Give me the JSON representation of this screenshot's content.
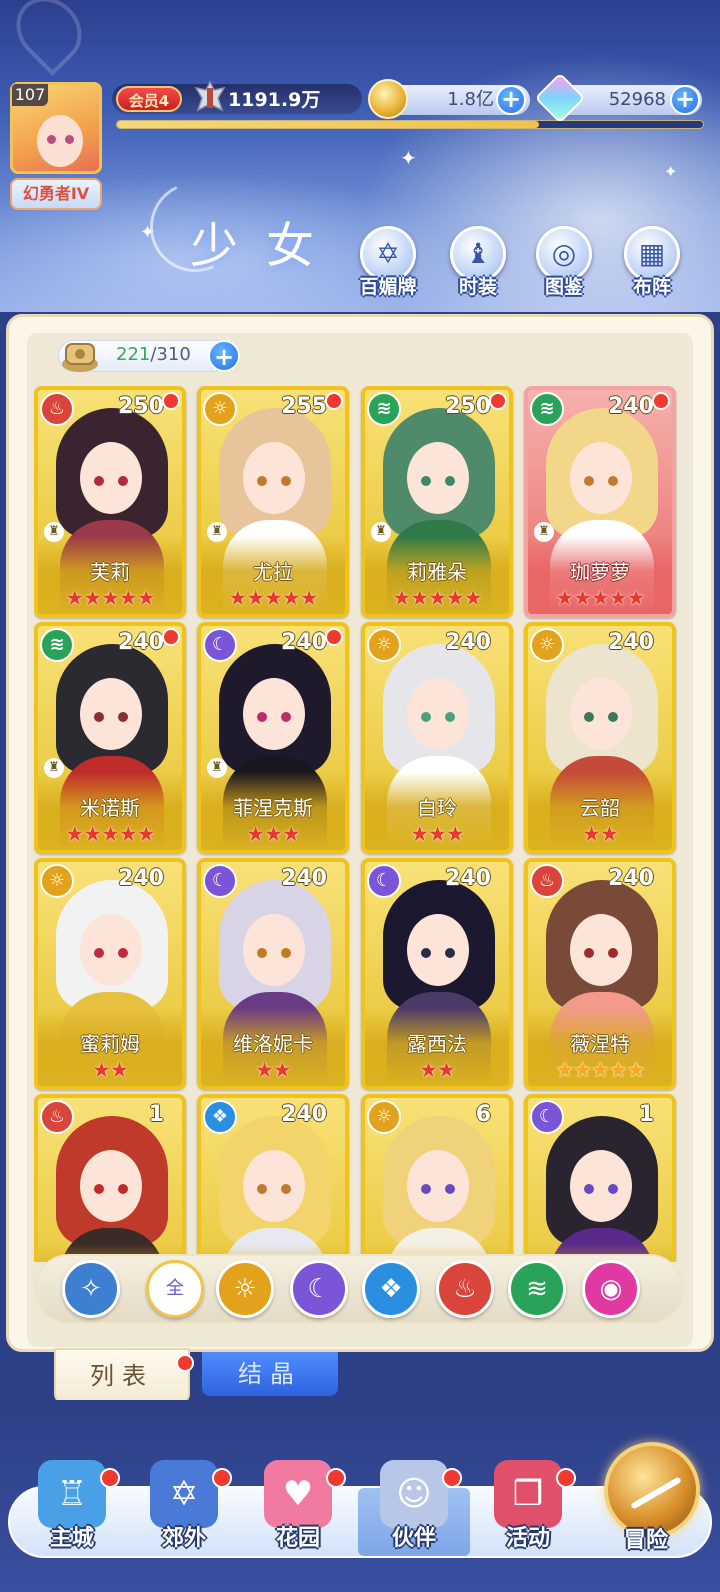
{
  "player": {
    "level": "107",
    "title": "幻勇者IV",
    "vip": "会员4",
    "power": "1191.9万",
    "exp_fraction": 0.72
  },
  "currency": {
    "gold": "1.8亿",
    "gems": "52968"
  },
  "page": {
    "title": "少女"
  },
  "top_buttons": [
    {
      "label": "百媚牌",
      "icon": "card-icon"
    },
    {
      "label": "时装",
      "icon": "costume-icon"
    },
    {
      "label": "图鉴",
      "icon": "book-icon"
    },
    {
      "label": "布阵",
      "icon": "formation-grid-icon"
    }
  ],
  "capacity": {
    "current": "221",
    "max": "/310"
  },
  "characters": [
    {
      "name": "芙莉",
      "level": "250",
      "element": "fire",
      "stars": 5,
      "star_color": "red",
      "frame": "gold",
      "has_rook": true,
      "dot": true
    },
    {
      "name": "尤拉",
      "level": "255",
      "element": "light",
      "stars": 5,
      "star_color": "red",
      "frame": "gold",
      "has_rook": true,
      "dot": true
    },
    {
      "name": "莉雅朵",
      "level": "250",
      "element": "wind",
      "stars": 5,
      "star_color": "red",
      "frame": "gold",
      "has_rook": true,
      "dot": true
    },
    {
      "name": "珈萝萝",
      "level": "240",
      "element": "wind",
      "stars": 5,
      "star_color": "red",
      "frame": "red",
      "has_rook": true,
      "dot": true
    },
    {
      "name": "米诺斯",
      "level": "240",
      "element": "wind",
      "stars": 5,
      "star_color": "red",
      "frame": "gold",
      "has_rook": true,
      "dot": true
    },
    {
      "name": "菲涅克斯",
      "level": "240",
      "element": "dark",
      "stars": 3,
      "star_color": "red",
      "frame": "gold",
      "has_rook": true,
      "dot": true
    },
    {
      "name": "白玲",
      "level": "240",
      "element": "light",
      "stars": 3,
      "star_color": "red",
      "frame": "gold",
      "has_rook": false,
      "dot": false
    },
    {
      "name": "云韶",
      "level": "240",
      "element": "light",
      "stars": 2,
      "star_color": "red",
      "frame": "gold",
      "has_rook": false,
      "dot": false
    },
    {
      "name": "蜜莉姆",
      "level": "240",
      "element": "light",
      "stars": 2,
      "star_color": "red",
      "frame": "gold",
      "has_rook": false,
      "dot": false
    },
    {
      "name": "维洛妮卡",
      "level": "240",
      "element": "dark",
      "stars": 2,
      "star_color": "red",
      "frame": "gold",
      "has_rook": false,
      "dot": false
    },
    {
      "name": "露西法",
      "level": "240",
      "element": "dark",
      "stars": 2,
      "star_color": "red",
      "frame": "gold",
      "has_rook": false,
      "dot": false
    },
    {
      "name": "薇涅特",
      "level": "240",
      "element": "fire",
      "stars": 5,
      "star_color": "gold",
      "frame": "gold",
      "has_rook": false,
      "dot": false
    },
    {
      "name": "",
      "level": "1",
      "element": "fire",
      "stars": 0,
      "star_color": "red",
      "frame": "gold",
      "has_rook": false,
      "dot": false
    },
    {
      "name": "",
      "level": "240",
      "element": "water",
      "stars": 0,
      "star_color": "red",
      "frame": "gold",
      "has_rook": false,
      "dot": false
    },
    {
      "name": "",
      "level": "6",
      "element": "light",
      "stars": 0,
      "star_color": "red",
      "frame": "gold",
      "has_rook": false,
      "dot": false
    },
    {
      "name": "",
      "level": "1",
      "element": "dark",
      "stars": 0,
      "star_color": "red",
      "frame": "gold",
      "has_rook": false,
      "dot": false
    }
  ],
  "filters": [
    {
      "id": "special",
      "label": "",
      "color": "#3d7fd1"
    },
    {
      "id": "all",
      "label": "全",
      "color": "#ffffff"
    },
    {
      "id": "light",
      "label": "",
      "color": "#e2a21c"
    },
    {
      "id": "dark",
      "label": "",
      "color": "#7a55d8"
    },
    {
      "id": "water",
      "label": "",
      "color": "#2a8fe0"
    },
    {
      "id": "fire",
      "label": "",
      "color": "#d9453a"
    },
    {
      "id": "wind",
      "label": "",
      "color": "#2aa35a"
    },
    {
      "id": "chaos",
      "label": "",
      "color": "#e03aa2"
    }
  ],
  "tabs": {
    "list": "列表",
    "crystal": "结晶"
  },
  "nav": [
    {
      "label": "主城",
      "icon": "castle-icon",
      "dot": true
    },
    {
      "label": "郊外",
      "icon": "portal-icon",
      "dot": true
    },
    {
      "label": "花园",
      "icon": "heart-garden-icon",
      "dot": true
    },
    {
      "label": "伙伴",
      "icon": "partner-icon",
      "dot": true,
      "active": true
    },
    {
      "label": "活动",
      "icon": "gift-icon",
      "dot": true
    },
    {
      "label": "冒险",
      "icon": "compass-icon",
      "dot": false
    }
  ],
  "colors": {
    "element_fire": "#d9453a",
    "element_light": "#e2a21c",
    "element_wind": "#2aa35a",
    "element_dark": "#7a55d8",
    "element_water": "#2a8fe0",
    "accent_blue": "#2a72e6",
    "notify_red": "#f03a2f"
  }
}
